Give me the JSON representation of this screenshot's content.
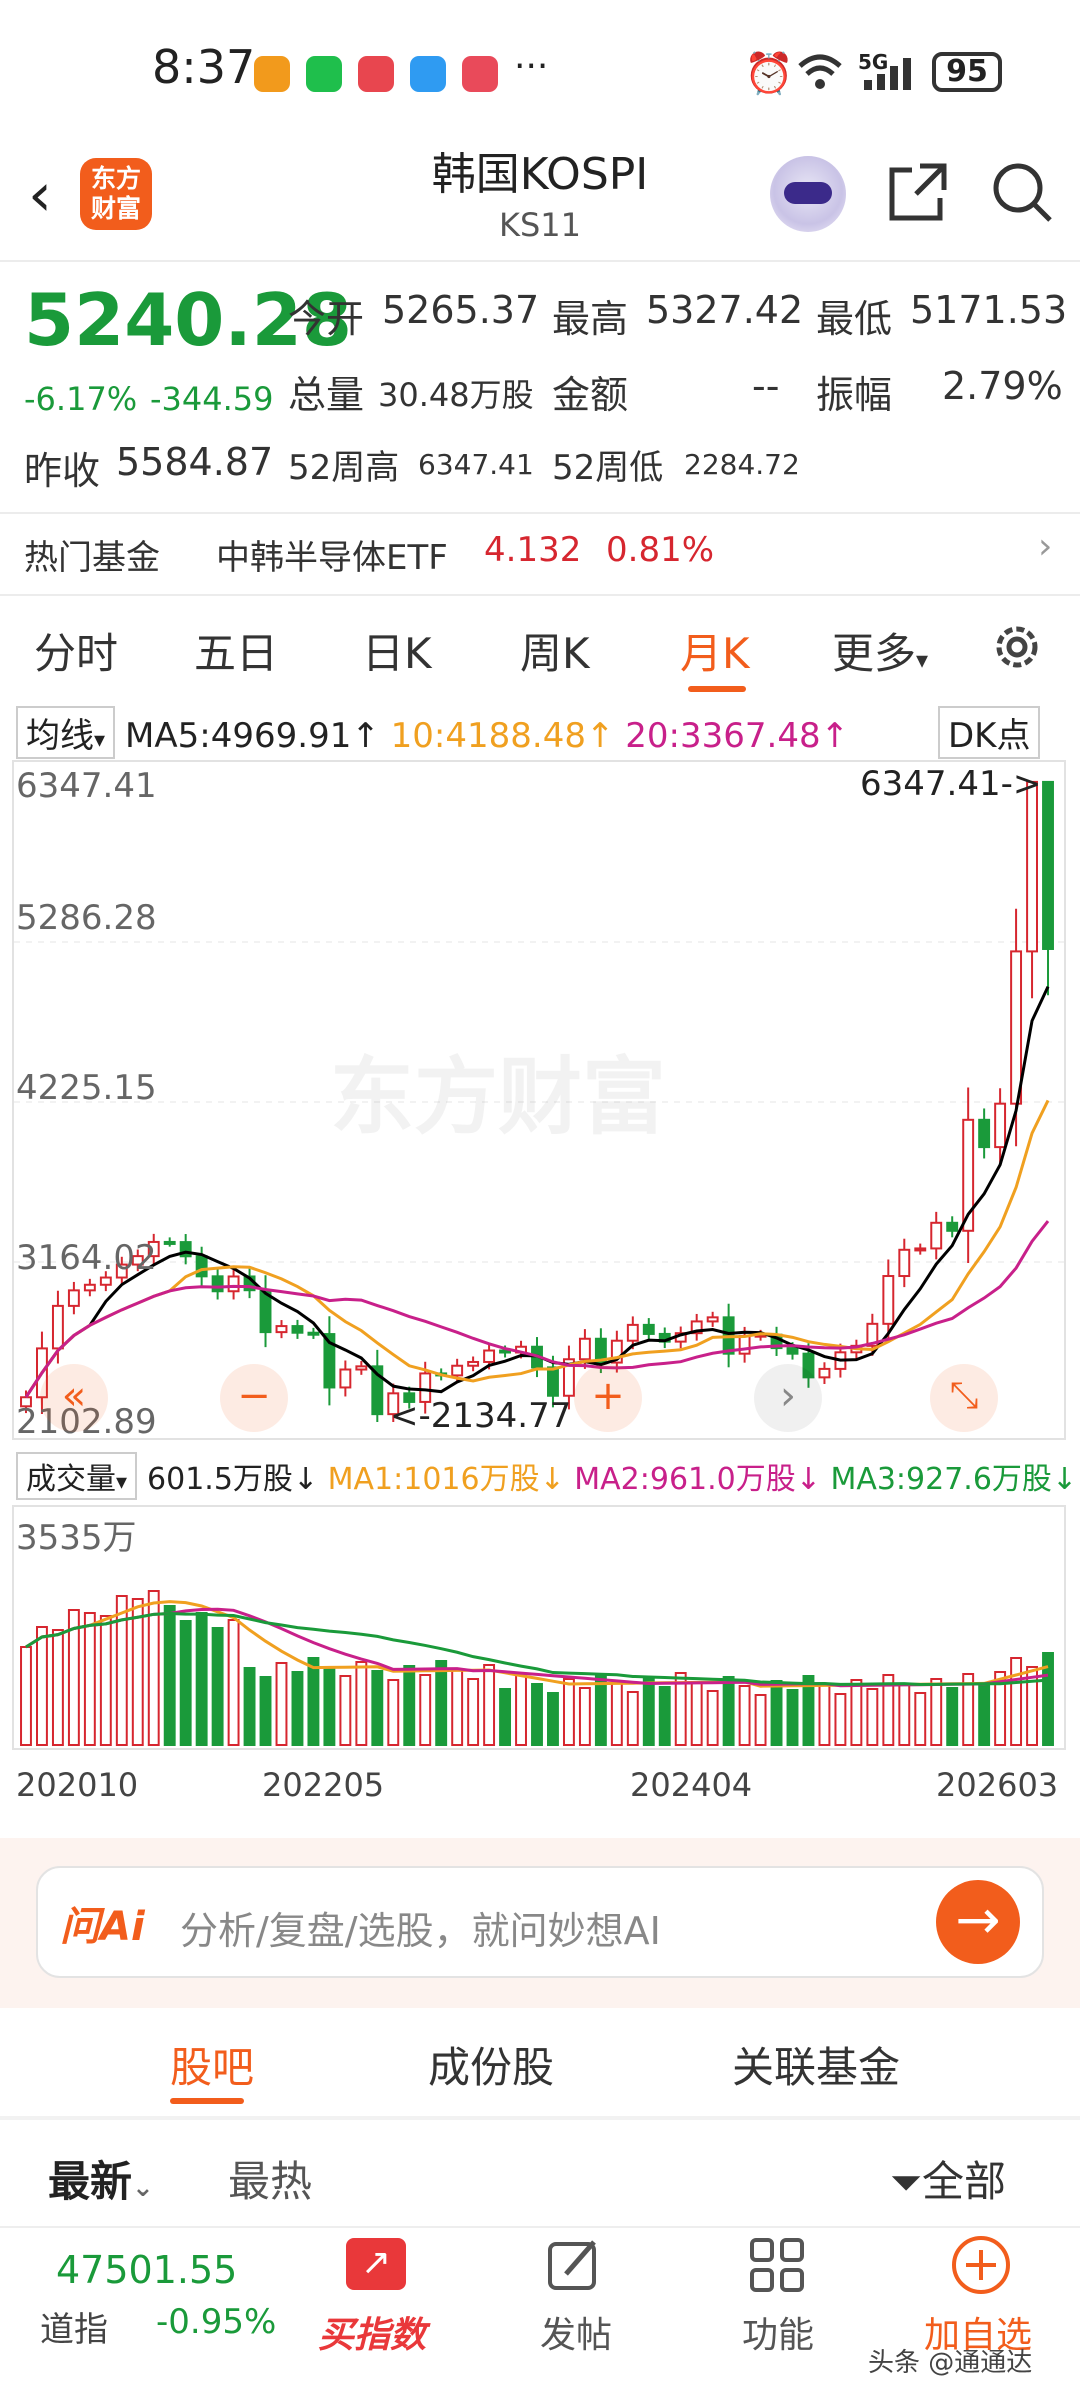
{
  "status_bar": {
    "time": "8:37",
    "network": "5G",
    "battery": "95"
  },
  "header": {
    "title": "韩国KOSPI",
    "code": "KS11",
    "logo_text": "东方财富"
  },
  "quote": {
    "price": "5240.28",
    "change_pct": "-6.17%",
    "change": "-344.59",
    "open_label": "今开",
    "open": "5265.37",
    "high_label": "最高",
    "high": "5327.42",
    "low_label": "最低",
    "low": "5171.53",
    "volume_label": "总量",
    "volume": "30.48万股",
    "amount_label": "金额",
    "amount": "--",
    "amplitude_label": "振幅",
    "amplitude": "2.79%",
    "prev_close_label": "昨收",
    "prev_close": "5584.87",
    "w52_high_label": "52周高",
    "w52_high": "6347.41",
    "w52_low_label": "52周低",
    "w52_low": "2284.72"
  },
  "hot_fund": {
    "label": "热门基金",
    "name": "中韩半导体ETF",
    "price": "4.132",
    "change": "0.81%"
  },
  "period_tabs": [
    "分时",
    "五日",
    "日K",
    "周K",
    "月K",
    "更多"
  ],
  "active_period": "月K",
  "ma_bar": {
    "selector": "均线",
    "ma5": "MA5:4969.91",
    "ma10": "10:4188.48",
    "ma20": "20:3367.48",
    "dk": "DK点"
  },
  "chart": {
    "y_labels": [
      "6347.41",
      "5286.28",
      "4225.15",
      "3164.02",
      "2102.89"
    ],
    "max_annotation": "6347.41->",
    "min_annotation": "<-2134.77",
    "watermark": "东方财富",
    "vol_selector": "成交量",
    "vol_value": "601.5万股",
    "vol_ma1": "MA1:1016万股",
    "vol_ma2": "MA2:961.0万股",
    "vol_ma3": "MA3:927.6万股",
    "vol_top_label": "3535万",
    "x_labels": [
      "202010",
      "202205",
      "202404",
      "202603"
    ]
  },
  "chart_data": {
    "type": "candlestick",
    "title": "",
    "ylim": [
      2102.89,
      6347.41
    ],
    "x_labels": [
      "202010",
      "202205",
      "202404",
      "202603"
    ],
    "close": [
      2267,
      2591,
      2873,
      2976,
      3013,
      3061,
      3147,
      3203,
      3297,
      3296,
      3202,
      3069,
      2970,
      3068,
      2977,
      2699,
      2739,
      2695,
      2686,
      2332,
      2451,
      2472,
      2155,
      2293,
      2236,
      2425,
      2412,
      2476,
      2501,
      2577,
      2564,
      2602,
      2465,
      2277,
      2519,
      2655,
      2497,
      2642,
      2747,
      2687,
      2636,
      2692,
      2770,
      2797,
      2556,
      2674,
      2682,
      2593,
      2556,
      2399,
      2455,
      2565,
      2608,
      2754,
      3071,
      3245,
      3254,
      3424,
      3371,
      4107,
      3926,
      4214,
      5224,
      6348,
      5240
    ],
    "colors": {
      "up": "#d6262f",
      "down": "#1a9a3a",
      "ma5": "#000000",
      "ma10": "#f0a020",
      "ma20": "#c8208a"
    }
  },
  "ai_bar": {
    "logo": "问Ai",
    "placeholder": "分析/复盘/选股，就问妙想AI"
  },
  "section_tabs": [
    "股吧",
    "成份股",
    "关联基金"
  ],
  "sub_tabs": {
    "latest": "最新",
    "hot": "最热",
    "filter": "全部"
  },
  "bottom_nav": {
    "dow_value": "47501.55",
    "dow_label": "道指",
    "dow_change": "-0.95%",
    "buy_index": "买指数",
    "post": "发帖",
    "function": "功能",
    "add_watch": "加自选"
  },
  "footer_watermark": "头条 @通通达"
}
